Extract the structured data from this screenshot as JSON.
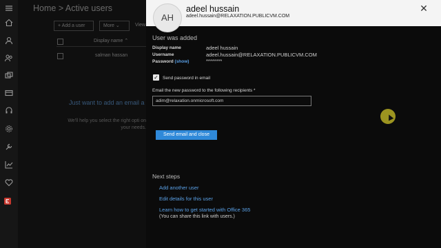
{
  "background": {
    "breadcrumb": "Home > Active users",
    "add_user_button": "+ Add a user",
    "more_button": "More",
    "view_label": "View",
    "col_display_name": "Display name",
    "row_name": "salman hassan",
    "cta_text": "Just want to add an email a",
    "help_text": "We'll help you select the right opti on your needs."
  },
  "panel": {
    "avatar_initials": "AH",
    "name": "adeel hussain",
    "email": "adeel.hussain@RELAXATION.PUBLICVM.COM",
    "section_title": "User was added",
    "labels": {
      "display_name": "Display name",
      "username": "Username",
      "password": "Password",
      "show": "(show)"
    },
    "values": {
      "display_name": "adeel hussain",
      "username": "adeel.hussain@RELAXATION.PUBLICVM.COM",
      "password": "********"
    },
    "send_password_checkbox_label": "Send password in email",
    "send_password_checked": true,
    "recipients_label": "Email the new password to the following recipients *",
    "recipients_value": "adim@relaxation.onmicrosoft.com",
    "send_button": "Send email and close",
    "next_steps_title": "Next steps",
    "next_steps": [
      "Add another user",
      "Edit details for this user",
      "Learn how to get started with Office 365"
    ],
    "share_note": "(You can share this link with users.)"
  },
  "rail_icons": [
    "home-icon",
    "user-icon",
    "group-icon",
    "resources-icon",
    "billing-icon",
    "support-icon",
    "settings-icon",
    "setup-icon",
    "reports-icon",
    "health-icon",
    "exchange-icon"
  ],
  "colors": {
    "accent": "#2f89d9",
    "link": "#5aa0e6",
    "header_bg": "#f4f4f4",
    "exchange": "#c8372d"
  }
}
